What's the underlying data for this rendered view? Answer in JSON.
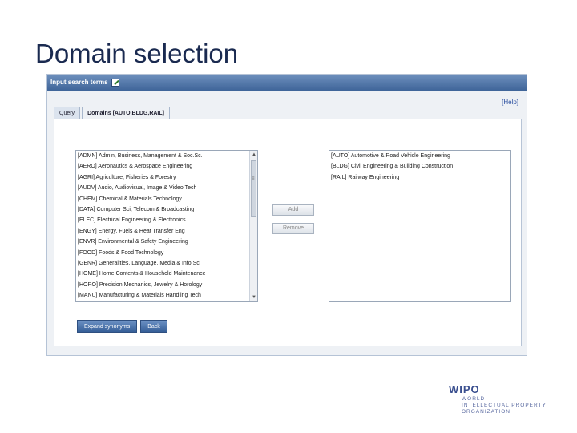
{
  "slide": {
    "title": "Domain selection"
  },
  "panel": {
    "header_title": "Input search terms",
    "help": "[Help]",
    "tabs": [
      {
        "label": "Query",
        "active": false
      },
      {
        "label": "Domains [AUTO,BLDG,RAIL]",
        "active": true
      }
    ]
  },
  "domains_list": [
    "[ADMN] Admin, Business, Management & Soc.Sc.",
    "[AERO] Aeronautics & Aerospace Engineering",
    "[AGRI] Agriculture, Fisheries & Forestry",
    "[AUDV] Audio, Audiovisual, Image & Video Tech",
    "[CHEM] Chemical & Materials Technology",
    "[DATA] Computer Sci, Telecom & Broadcasting",
    "[ELEC] Electrical Engineering & Electronics",
    "[ENGY] Energy, Fuels & Heat Transfer Eng",
    "[ENVR] Environmental & Safety Engineering",
    "[FOOD] Foods & Food Technology",
    "[GENR] Generalities, Language, Media & Info.Sci",
    "[HOME] Home Contents & Household Maintenance",
    "[HORO] Precision Mechanics, Jewelry & Horology",
    "[MANU] Manufacturing & Materials Handling Tech"
  ],
  "selected_list": [
    "[AUTO] Automotive & Road Vehicle Engineering",
    "[BLDG] Civil Engineering & Building Construction",
    "[RAIL] Railway Engineering"
  ],
  "buttons": {
    "add": "Add",
    "remove": "Remove",
    "expand_synonyms": "Expand synonyms",
    "back": "Back"
  },
  "logo": {
    "mark": "WIPO",
    "line1": "WORLD",
    "line2": "INTELLECTUAL PROPERTY",
    "line3": "ORGANIZATION"
  },
  "colors": {
    "header_blue": "#3f6599",
    "title_navy": "#1a2a50",
    "logo_blue": "#3a4f8f"
  }
}
